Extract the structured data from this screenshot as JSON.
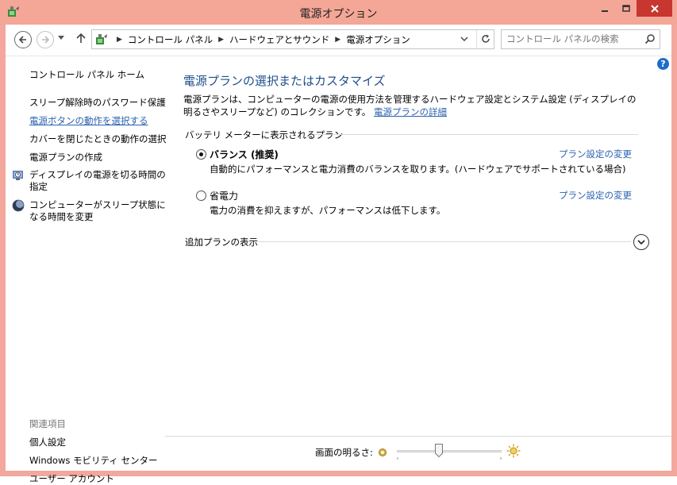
{
  "window": {
    "title": "電源オプション"
  },
  "address": {
    "crumbs": [
      "コントロール パネル",
      "ハードウェアとサウンド",
      "電源オプション"
    ]
  },
  "search": {
    "placeholder": "コントロール パネルの検索"
  },
  "sidebar": {
    "home": "コントロール パネル ホーム",
    "links": [
      "スリープ解除時のパスワード保護",
      "電源ボタンの動作を選択する",
      "カバーを閉じたときの動作の選択",
      "電源プランの作成"
    ],
    "icon_links": [
      "ディスプレイの電源を切る時間の指定",
      "コンピューターがスリープ状態になる時間を変更"
    ],
    "related_heading": "関連項目",
    "related": [
      "個人設定",
      "Windows モビリティ センター",
      "ユーザー アカウント"
    ]
  },
  "main": {
    "title": "電源プランの選択またはカスタマイズ",
    "description": "電源プランは、コンピューターの電源の使用方法を管理するハードウェア設定とシステム設定 (ディスプレイの明るさやスリープなど) のコレクションです。",
    "details_link": "電源プランの詳細",
    "group_heading": "バッテリ メーターに表示されるプラン",
    "plans": [
      {
        "name": "バランス (推奨)",
        "desc": "自動的にパフォーマンスと電力消費のバランスを取ります。(ハードウェアでサポートされている場合)",
        "link": "プラン設定の変更",
        "selected": true
      },
      {
        "name": "省電力",
        "desc": "電力の消費を抑えますが、パフォーマンスは低下します。",
        "link": "プラン設定の変更",
        "selected": false
      }
    ],
    "more_plans": "追加プランの表示"
  },
  "brightness": {
    "label": "画面の明るさ:",
    "level": 0.4
  },
  "colors": {
    "titlebar": "#f4a697",
    "close": "#c7372f",
    "link": "#2b62b0",
    "heading": "#1e4e8c"
  }
}
